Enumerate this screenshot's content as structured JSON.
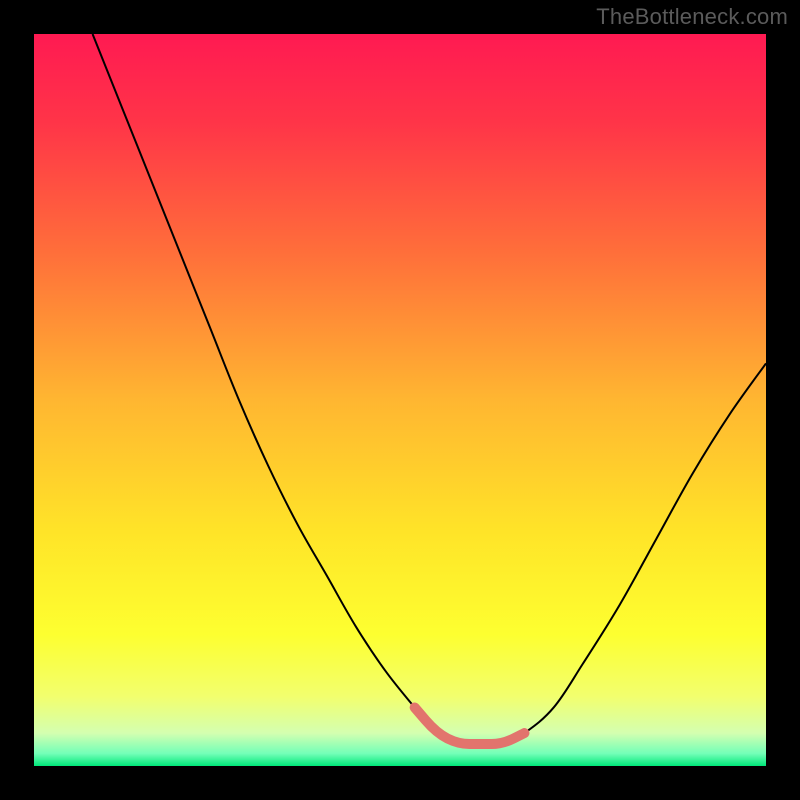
{
  "watermark": "TheBottleneck.com",
  "colors": {
    "frame": "#000000",
    "watermark": "#5b5b5b",
    "curve_stroke": "#000000",
    "trough_stroke": "#e2746d",
    "gradient_stops": [
      {
        "offset": 0.0,
        "color": "#ff1a52"
      },
      {
        "offset": 0.12,
        "color": "#ff3448"
      },
      {
        "offset": 0.3,
        "color": "#ff6f3a"
      },
      {
        "offset": 0.5,
        "color": "#ffb631"
      },
      {
        "offset": 0.68,
        "color": "#ffe428"
      },
      {
        "offset": 0.82,
        "color": "#fdff30"
      },
      {
        "offset": 0.905,
        "color": "#f2ff6e"
      },
      {
        "offset": 0.955,
        "color": "#d4ffb0"
      },
      {
        "offset": 0.983,
        "color": "#73ffb8"
      },
      {
        "offset": 1.0,
        "color": "#00e77a"
      }
    ]
  },
  "chart_data": {
    "type": "line",
    "title": "",
    "xlabel": "",
    "ylabel": "",
    "xlim": [
      0,
      100
    ],
    "ylim": [
      0,
      100
    ],
    "series": [
      {
        "name": "bottleneck-curve",
        "x": [
          8,
          12,
          16,
          20,
          24,
          28,
          32,
          36,
          40,
          44,
          48,
          52,
          55,
          58,
          61,
          64,
          67,
          71,
          75,
          80,
          85,
          90,
          95,
          100
        ],
        "values": [
          100,
          90,
          80,
          70,
          60,
          50,
          41,
          33,
          26,
          19,
          13,
          8,
          4.5,
          3,
          3,
          3,
          4.5,
          8,
          14,
          22,
          31,
          40,
          48,
          55
        ]
      }
    ],
    "annotations": [
      {
        "name": "trough-highlight",
        "x_range": [
          52,
          67
        ],
        "y": 3
      }
    ]
  }
}
